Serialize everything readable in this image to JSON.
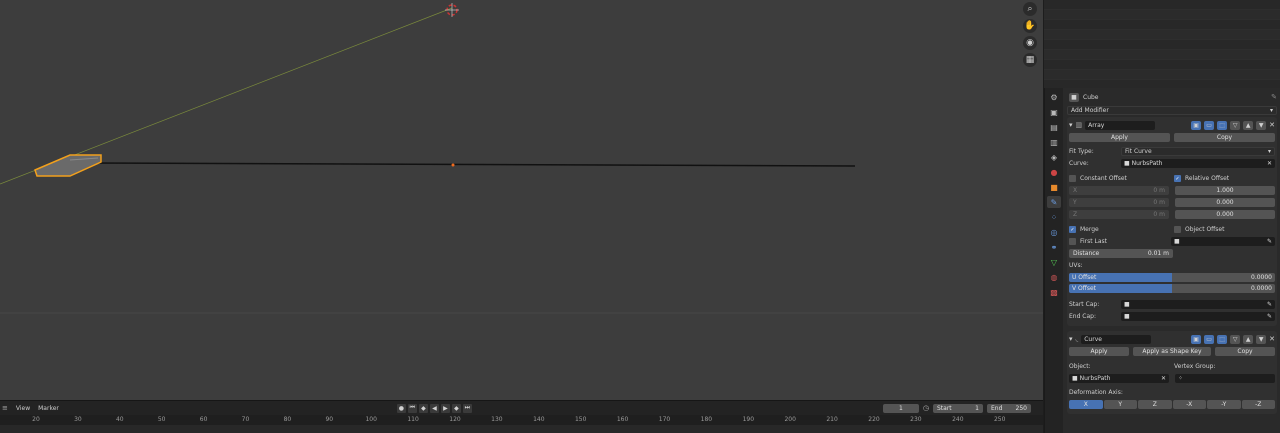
{
  "outliner": {
    "rows": 8
  },
  "properties": {
    "object_name": "Cube",
    "add_modifier": "Add Modifier",
    "array": {
      "name": "Array",
      "apply": "Apply",
      "copy": "Copy",
      "fit_type_label": "Fit Type:",
      "fit_type_value": "Fit Curve",
      "curve_label": "Curve:",
      "curve_value": "NurbsPath",
      "constant_offset": "Constant Offset",
      "relative_offset": "Relative Offset",
      "axes": [
        "X",
        "Y",
        "Z"
      ],
      "const_values": [
        "0 m",
        "0 m",
        "0 m"
      ],
      "rel_values": [
        "1.000",
        "0.000",
        "0.000"
      ],
      "merge": "Merge",
      "first_last": "First Last",
      "object_offset": "Object Offset",
      "distance_label": "Distance",
      "distance_value": "0.01 m",
      "uvs_label": "UVs:",
      "u_offset_label": "U Offset",
      "u_offset_value": "0.0000",
      "v_offset_label": "V Offset",
      "v_offset_value": "0.0000",
      "start_cap": "Start Cap:",
      "end_cap": "End Cap:"
    },
    "curve_mod": {
      "name": "Curve",
      "apply": "Apply",
      "apply_shape": "Apply as Shape Key",
      "copy": "Copy",
      "object_label": "Object:",
      "object_value": "NurbsPath",
      "vertex_group_label": "Vertex Group:",
      "deform_axis_label": "Deformation Axis:",
      "axes": [
        "X",
        "Y",
        "Z",
        "-X",
        "-Y",
        "-Z"
      ],
      "selected_axis": "X"
    }
  },
  "timeline": {
    "view": "View",
    "marker": "Marker",
    "current_frame": "1",
    "start_label": "Start",
    "start_value": "1",
    "end_label": "End",
    "end_value": "250",
    "ticks": [
      "20",
      "30",
      "40",
      "50",
      "60",
      "70",
      "80",
      "90",
      "100",
      "110",
      "120",
      "130",
      "140",
      "150",
      "160",
      "170",
      "180",
      "190",
      "200",
      "210",
      "220",
      "230",
      "240",
      "250"
    ]
  },
  "colors": {
    "accent": "#4772b3",
    "selection": "#f2a01c"
  }
}
